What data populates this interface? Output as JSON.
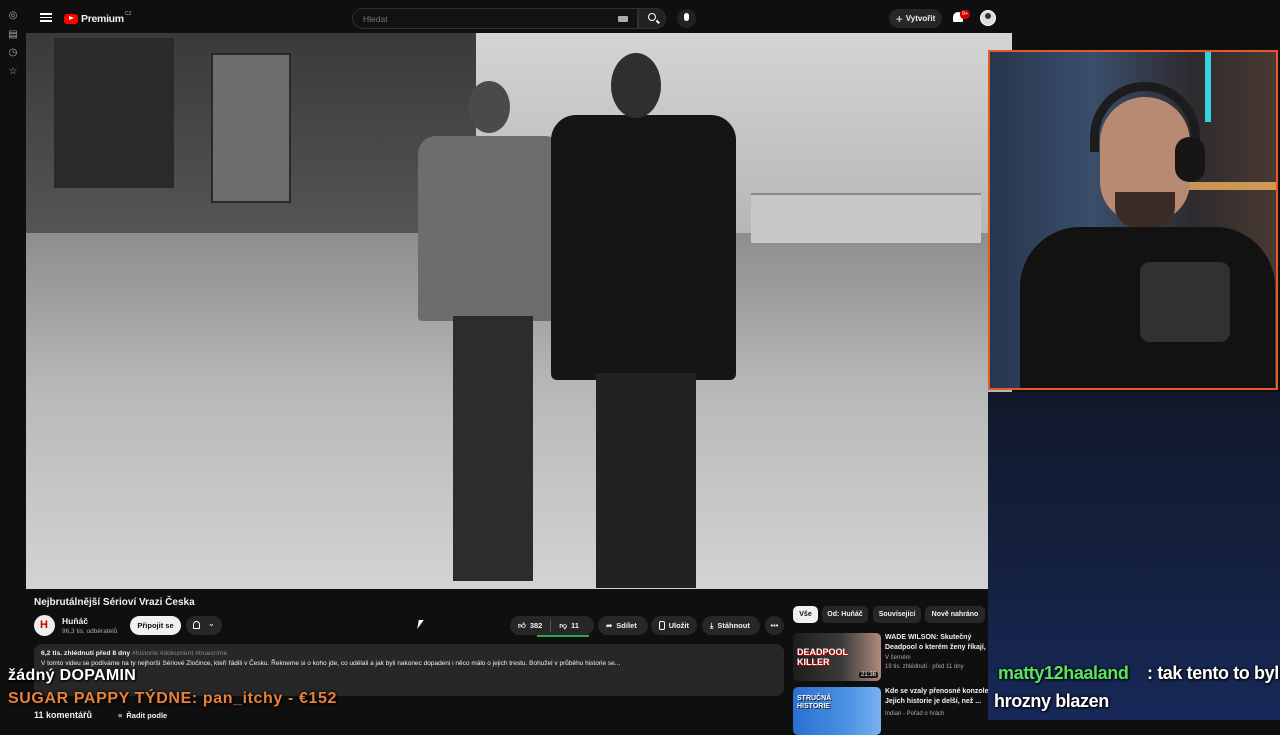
{
  "header": {
    "logo_text": "Premium",
    "logo_region": "CZ",
    "search_placeholder": "Hledat",
    "create_label": "Vytvořit",
    "notifications_badge": "9+"
  },
  "icons": {
    "menu": "hamburger-icon",
    "search": "search-icon",
    "mic": "mic-icon",
    "keyboard": "keyboard-icon",
    "bell": "bell-icon",
    "like": "thumbs-up-icon",
    "dislike": "thumbs-down-icon",
    "share": "share-icon",
    "save": "save-icon",
    "download": "download-icon"
  },
  "video": {
    "title": "Nejbrutálnější Sérioví Vrazi Česka",
    "channel_name": "Huňáč",
    "channel_subs": "96,3 tis. odběratelů",
    "join_label": "Připojit se",
    "likes": "382",
    "dislikes": "11",
    "share_label": "Sdílet",
    "save_label": "Uložit",
    "download_label": "Stáhnout",
    "more_label": "•••",
    "description_meta": "6,2 tis. zhlédnutí  před 8 dny",
    "description_tags": "#historie #dokument #truecrime",
    "description_text": "V tomto videu se podíváme na ty nejhorší Sériové Zločince, kteří řádili v Česku. Řekneme si o koho jde, co udělali a jak byli nakonec dopadeni i něco málo o jejich trestu. Bohužel v průběhu historie se...",
    "comments_count": "11 komentářů",
    "sort_label": "Řadit podle"
  },
  "chips": [
    "Vše",
    "Od: Huňáč",
    "Související",
    "Nově nahráno"
  ],
  "recommended": [
    {
      "title": "WADE WILSON: Skutečný Deadpool o kterém ženy říkají, ...",
      "channel": "V černém",
      "meta": "19 tis. zhlédnutí · před 11 dny",
      "duration": "21:36",
      "thumb_text": "DEADPOOL KILLER"
    },
    {
      "title": "Kde se vzaly přenosné konzole? Jejich historie je delší, než ...",
      "channel": "Indian - Pořad o hrách",
      "meta": "",
      "duration": "",
      "thumb_text": "STRUČNÁ HISTORIE"
    }
  ],
  "overlays": {
    "line1": "žádný DOPAMIN",
    "line2": "SUGAR PAPPY TÝDNE: pan_itchy - €152",
    "chat_user": "matty12haaland",
    "chat_msg1": ": tak tento to byl",
    "chat_msg2": "hrozny blazen"
  },
  "colors": {
    "accent_red": "#ff0000",
    "chat_user": "#5be35e",
    "overlay_orange": "#e8823a",
    "webcam_border": "#e05a2a"
  }
}
